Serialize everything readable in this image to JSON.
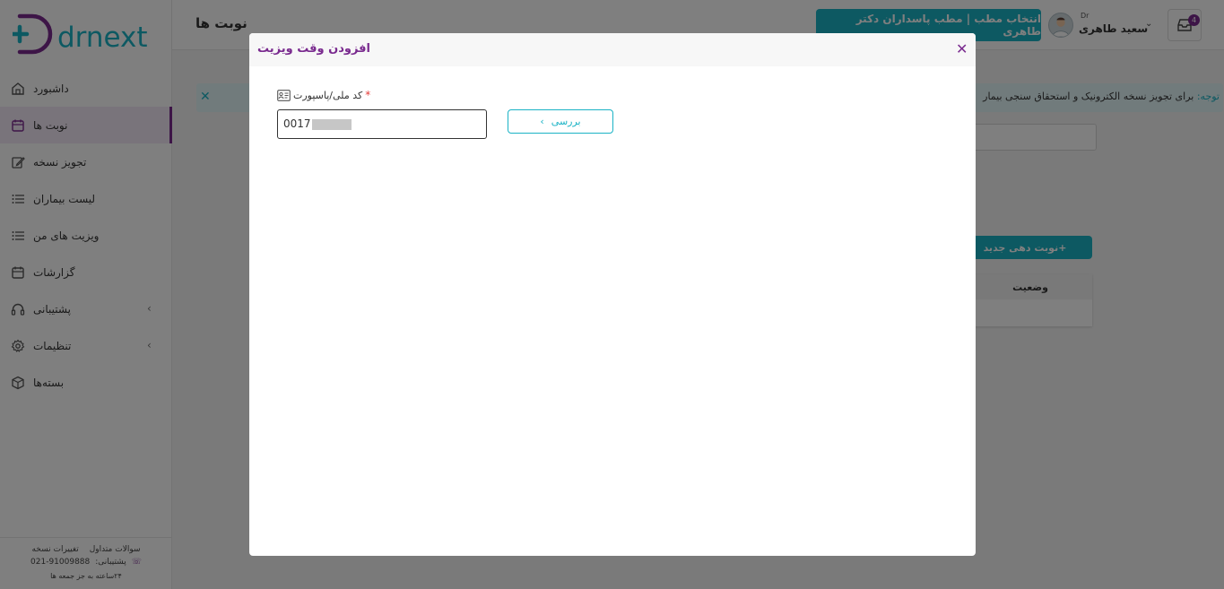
{
  "brand": {
    "logo_text": "drnext",
    "accent": "#1ab3c5",
    "primary": "#7a2b8f"
  },
  "sidebar": {
    "items": [
      {
        "label": "داشبورد",
        "icon": "home-icon"
      },
      {
        "label": "نوبت ها",
        "icon": "calendar-icon",
        "active": true
      },
      {
        "label": "تجویز نسخه",
        "icon": "edit-icon"
      },
      {
        "label": "لیست بیماران",
        "icon": "list-icon"
      },
      {
        "label": "ویزیت های من",
        "icon": "list-icon"
      },
      {
        "label": "گزارشات",
        "icon": "calendar-icon"
      },
      {
        "label": "پشتیبانی",
        "icon": "headset-icon",
        "expandable": true
      },
      {
        "label": "تنظیمات",
        "icon": "gear-icon",
        "expandable": true
      },
      {
        "label": "بسته‌ها",
        "icon": "package-icon"
      }
    ],
    "footer": {
      "faq": "سوالات متداول",
      "changes": "تغییرات نسخه",
      "support_label": "پشتیبانی:",
      "support_phone": "021-91009888",
      "hours": "۲۴ساعته به جز جمعه ها"
    }
  },
  "header": {
    "page_title": "نوبت ها",
    "clinic_button": "انتخاب مطب | مطب پاسداران دکتر طاهری",
    "user_title": "Dr",
    "user_name": "سعید طاهری",
    "inbox_count": "4"
  },
  "main": {
    "alert_lead": "توجه:",
    "alert_text": "برای تجویز نسخه الکترونیک و استحقاق سنجی بیمار",
    "new_appointment": "+نوبت دهی جدید",
    "table_header_status": "وضعیت"
  },
  "modal": {
    "title": "افزودن وقت ویزیت",
    "field_label": "کد ملی/پاسپورت",
    "required_mark": "*",
    "input_value": "0017",
    "check_button": "بررسی"
  }
}
